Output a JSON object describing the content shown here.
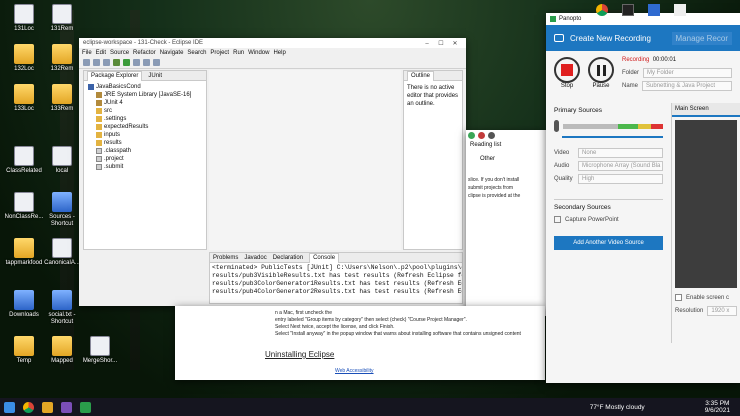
{
  "desktop_icons": [
    {
      "label": "131Loc",
      "kind": "file"
    },
    {
      "label": "131Rem",
      "kind": "file"
    },
    {
      "label": "132Loc",
      "kind": "folder"
    },
    {
      "label": "132Rem",
      "kind": "folder"
    },
    {
      "label": "133Loc",
      "kind": "folder"
    },
    {
      "label": "133Rem",
      "kind": "folder"
    },
    {
      "label": "ClassRelated",
      "kind": "file"
    },
    {
      "label": "local",
      "kind": "file"
    },
    {
      "label": "NonClassRe...",
      "kind": "file"
    },
    {
      "label": "Sources - Shortcut",
      "kind": "sc"
    },
    {
      "label": "tappmarkfood",
      "kind": "folder"
    },
    {
      "label": "CanonicalA...",
      "kind": "file"
    },
    {
      "label": "Downloads",
      "kind": "sc"
    },
    {
      "label": "social.txt - Shortcut",
      "kind": "sc"
    },
    {
      "label": "Temp",
      "kind": "folder"
    },
    {
      "label": "Mapped",
      "kind": "folder"
    },
    {
      "label": "MergeShor...",
      "kind": "file"
    },
    {
      "label": "Recycle Bin",
      "kind": "bin"
    }
  ],
  "eclipse": {
    "title": "eclipse-workspace - 131-Check - Eclipse IDE",
    "menu": [
      "File",
      "Edit",
      "Source",
      "Refactor",
      "Navigate",
      "Search",
      "Project",
      "Run",
      "Window",
      "Help"
    ],
    "explorer_tabs": [
      "Package Explorer",
      "JUnit"
    ],
    "tree": [
      {
        "label": "JavaBasicsCond",
        "depth": 0,
        "kind": "proj"
      },
      {
        "label": "JRE System Library [JavaSE-16]",
        "depth": 1,
        "kind": "lib"
      },
      {
        "label": "JUnit 4",
        "depth": 1,
        "kind": "lib"
      },
      {
        "label": "src",
        "depth": 1,
        "kind": "fld"
      },
      {
        "label": ".settings",
        "depth": 1,
        "kind": "fld"
      },
      {
        "label": "expectedResults",
        "depth": 1,
        "kind": "fld"
      },
      {
        "label": "inputs",
        "depth": 1,
        "kind": "fld"
      },
      {
        "label": "results",
        "depth": 1,
        "kind": "fld"
      },
      {
        "label": ".classpath",
        "depth": 1,
        "kind": "doc"
      },
      {
        "label": ".project",
        "depth": 1,
        "kind": "doc"
      },
      {
        "label": ".submit",
        "depth": 1,
        "kind": "doc"
      }
    ],
    "outline": {
      "tab": "Outline",
      "text": "There is no active editor that provides an outline."
    },
    "bottom_tabs": [
      "Problems",
      "Javadoc",
      "Declaration",
      "Console"
    ],
    "console": [
      "<terminated> PublicTests [JUnit] C:\\Users\\Nelson\\.p2\\pool\\plugins\\org.eclipse.justj.openjdk.hotspot.",
      "results/pub3VisibleResults.txt has test results (Refresh Eclipse folde",
      "results/pub3ColorGenerator1Results.txt has test results (Refresh Eclipse",
      "results/pub4ColorGenerator2Results.txt has test results (Refresh Eclipse"
    ]
  },
  "browser": {
    "reading_list": "Reading list",
    "other": "Other",
    "snippets": [
      "slice. If you don't install",
      "submit projects from",
      "clipse is provided at the"
    ],
    "bottom_lines": [
      "n a Mac, first uncheck the",
      "entry labeled \"Group items by category\" then select (check) \"Course Project Manager\".",
      "Select Next twice, accept the license, and click Finish.",
      "Select \"Install anyway\" in the popup window that warns about installing software that contains unsigned content"
    ],
    "heading": "Uninstalling Eclipse",
    "footer": "Web Accessibility"
  },
  "panopto": {
    "title": "Panopto",
    "new_recording": "Create New Recording",
    "manage": "Manage Recor",
    "stop": "Stop",
    "pause": "Pause",
    "status": "Recording",
    "time": "00:00:01",
    "folder_label": "Folder",
    "folder_value": "My Folder",
    "name_label": "Name",
    "name_value": "Subnetting & Java Project",
    "primary_sources": "Primary Sources",
    "video_label": "Video",
    "video_value": "None",
    "audio_label": "Audio",
    "audio_value": "Microphone Array (Sound Bla",
    "quality_label": "Quality",
    "quality_value": "High",
    "secondary_sources": "Secondary Sources",
    "capture_ppt": "Capture PowerPoint",
    "add_video": "Add Another Video Source",
    "main_screen": "Main Screen",
    "enable_screen": "Enable screen c",
    "resolution_label": "Resolution",
    "resolution_value": "1920 x",
    "accent": "#1d77c1"
  },
  "taskbar": {
    "weather": "77°F  Mostly cloudy",
    "time": "3:35 PM",
    "date": "9/6/2021"
  }
}
